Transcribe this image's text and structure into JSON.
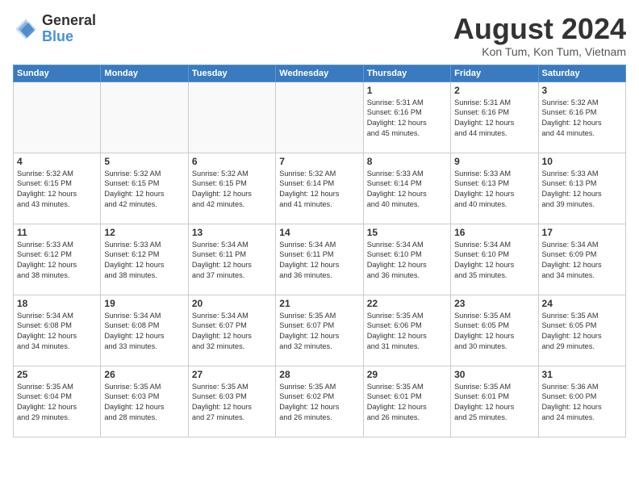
{
  "logo": {
    "general": "General",
    "blue": "Blue"
  },
  "title": "August 2024",
  "location": "Kon Tum, Kon Tum, Vietnam",
  "headers": [
    "Sunday",
    "Monday",
    "Tuesday",
    "Wednesday",
    "Thursday",
    "Friday",
    "Saturday"
  ],
  "weeks": [
    [
      {
        "day": "",
        "info": ""
      },
      {
        "day": "",
        "info": ""
      },
      {
        "day": "",
        "info": ""
      },
      {
        "day": "",
        "info": ""
      },
      {
        "day": "1",
        "info": "Sunrise: 5:31 AM\nSunset: 6:16 PM\nDaylight: 12 hours\nand 45 minutes."
      },
      {
        "day": "2",
        "info": "Sunrise: 5:31 AM\nSunset: 6:16 PM\nDaylight: 12 hours\nand 44 minutes."
      },
      {
        "day": "3",
        "info": "Sunrise: 5:32 AM\nSunset: 6:16 PM\nDaylight: 12 hours\nand 44 minutes."
      }
    ],
    [
      {
        "day": "4",
        "info": "Sunrise: 5:32 AM\nSunset: 6:15 PM\nDaylight: 12 hours\nand 43 minutes."
      },
      {
        "day": "5",
        "info": "Sunrise: 5:32 AM\nSunset: 6:15 PM\nDaylight: 12 hours\nand 42 minutes."
      },
      {
        "day": "6",
        "info": "Sunrise: 5:32 AM\nSunset: 6:15 PM\nDaylight: 12 hours\nand 42 minutes."
      },
      {
        "day": "7",
        "info": "Sunrise: 5:32 AM\nSunset: 6:14 PM\nDaylight: 12 hours\nand 41 minutes."
      },
      {
        "day": "8",
        "info": "Sunrise: 5:33 AM\nSunset: 6:14 PM\nDaylight: 12 hours\nand 40 minutes."
      },
      {
        "day": "9",
        "info": "Sunrise: 5:33 AM\nSunset: 6:13 PM\nDaylight: 12 hours\nand 40 minutes."
      },
      {
        "day": "10",
        "info": "Sunrise: 5:33 AM\nSunset: 6:13 PM\nDaylight: 12 hours\nand 39 minutes."
      }
    ],
    [
      {
        "day": "11",
        "info": "Sunrise: 5:33 AM\nSunset: 6:12 PM\nDaylight: 12 hours\nand 38 minutes."
      },
      {
        "day": "12",
        "info": "Sunrise: 5:33 AM\nSunset: 6:12 PM\nDaylight: 12 hours\nand 38 minutes."
      },
      {
        "day": "13",
        "info": "Sunrise: 5:34 AM\nSunset: 6:11 PM\nDaylight: 12 hours\nand 37 minutes."
      },
      {
        "day": "14",
        "info": "Sunrise: 5:34 AM\nSunset: 6:11 PM\nDaylight: 12 hours\nand 36 minutes."
      },
      {
        "day": "15",
        "info": "Sunrise: 5:34 AM\nSunset: 6:10 PM\nDaylight: 12 hours\nand 36 minutes."
      },
      {
        "day": "16",
        "info": "Sunrise: 5:34 AM\nSunset: 6:10 PM\nDaylight: 12 hours\nand 35 minutes."
      },
      {
        "day": "17",
        "info": "Sunrise: 5:34 AM\nSunset: 6:09 PM\nDaylight: 12 hours\nand 34 minutes."
      }
    ],
    [
      {
        "day": "18",
        "info": "Sunrise: 5:34 AM\nSunset: 6:08 PM\nDaylight: 12 hours\nand 34 minutes."
      },
      {
        "day": "19",
        "info": "Sunrise: 5:34 AM\nSunset: 6:08 PM\nDaylight: 12 hours\nand 33 minutes."
      },
      {
        "day": "20",
        "info": "Sunrise: 5:34 AM\nSunset: 6:07 PM\nDaylight: 12 hours\nand 32 minutes."
      },
      {
        "day": "21",
        "info": "Sunrise: 5:35 AM\nSunset: 6:07 PM\nDaylight: 12 hours\nand 32 minutes."
      },
      {
        "day": "22",
        "info": "Sunrise: 5:35 AM\nSunset: 6:06 PM\nDaylight: 12 hours\nand 31 minutes."
      },
      {
        "day": "23",
        "info": "Sunrise: 5:35 AM\nSunset: 6:05 PM\nDaylight: 12 hours\nand 30 minutes."
      },
      {
        "day": "24",
        "info": "Sunrise: 5:35 AM\nSunset: 6:05 PM\nDaylight: 12 hours\nand 29 minutes."
      }
    ],
    [
      {
        "day": "25",
        "info": "Sunrise: 5:35 AM\nSunset: 6:04 PM\nDaylight: 12 hours\nand 29 minutes."
      },
      {
        "day": "26",
        "info": "Sunrise: 5:35 AM\nSunset: 6:03 PM\nDaylight: 12 hours\nand 28 minutes."
      },
      {
        "day": "27",
        "info": "Sunrise: 5:35 AM\nSunset: 6:03 PM\nDaylight: 12 hours\nand 27 minutes."
      },
      {
        "day": "28",
        "info": "Sunrise: 5:35 AM\nSunset: 6:02 PM\nDaylight: 12 hours\nand 26 minutes."
      },
      {
        "day": "29",
        "info": "Sunrise: 5:35 AM\nSunset: 6:01 PM\nDaylight: 12 hours\nand 26 minutes."
      },
      {
        "day": "30",
        "info": "Sunrise: 5:35 AM\nSunset: 6:01 PM\nDaylight: 12 hours\nand 25 minutes."
      },
      {
        "day": "31",
        "info": "Sunrise: 5:36 AM\nSunset: 6:00 PM\nDaylight: 12 hours\nand 24 minutes."
      }
    ]
  ]
}
